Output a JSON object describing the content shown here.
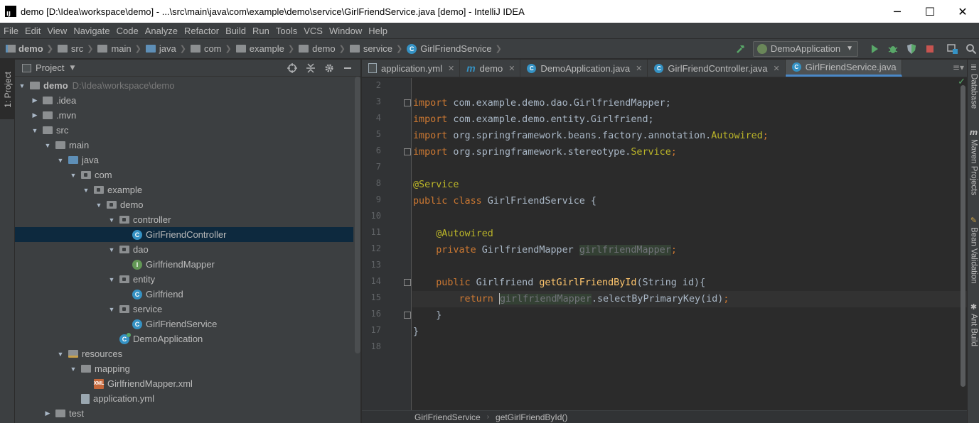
{
  "window": {
    "title": "demo [D:\\Idea\\workspace\\demo] - ...\\src\\main\\java\\com\\example\\demo\\service\\GirlFriendService.java [demo] - IntelliJ IDEA",
    "app_icon_text": "IJ",
    "minimize": "─",
    "maximize": "☐",
    "close": "✕"
  },
  "menu": [
    "File",
    "Edit",
    "View",
    "Navigate",
    "Code",
    "Analyze",
    "Refactor",
    "Build",
    "Run",
    "Tools",
    "VCS",
    "Window",
    "Help"
  ],
  "breadcrumbs": [
    "demo",
    "src",
    "main",
    "java",
    "com",
    "example",
    "demo",
    "service",
    "GirlFriendService"
  ],
  "run_config": {
    "selected": "DemoApplication"
  },
  "left_tool_tab": "1: Project",
  "project_panel": {
    "title": "Project",
    "tree": [
      {
        "label": "demo",
        "path": "D:\\Idea\\workspace\\demo",
        "level": 0,
        "expanded": true,
        "icon": "module-folder-icon"
      },
      {
        "label": ".idea",
        "level": 1,
        "expanded": false,
        "icon": "folder-icon"
      },
      {
        "label": ".mvn",
        "level": 1,
        "expanded": false,
        "icon": "folder-icon"
      },
      {
        "label": "src",
        "level": 1,
        "expanded": true,
        "icon": "folder-icon"
      },
      {
        "label": "main",
        "level": 2,
        "expanded": true,
        "icon": "folder-icon"
      },
      {
        "label": "java",
        "level": 3,
        "expanded": true,
        "icon": "source-folder-icon"
      },
      {
        "label": "com",
        "level": 4,
        "expanded": true,
        "icon": "package-icon"
      },
      {
        "label": "example",
        "level": 5,
        "expanded": true,
        "icon": "package-icon"
      },
      {
        "label": "demo",
        "level": 6,
        "expanded": true,
        "icon": "package-icon"
      },
      {
        "label": "controller",
        "level": 7,
        "expanded": true,
        "icon": "package-icon"
      },
      {
        "label": "GirlFriendController",
        "level": 8,
        "icon": "class-icon",
        "selected": true
      },
      {
        "label": "dao",
        "level": 7,
        "expanded": true,
        "icon": "package-icon"
      },
      {
        "label": "GirlfriendMapper",
        "level": 8,
        "icon": "interface-icon"
      },
      {
        "label": "entity",
        "level": 7,
        "expanded": true,
        "icon": "package-icon"
      },
      {
        "label": "Girlfriend",
        "level": 8,
        "icon": "class-icon"
      },
      {
        "label": "service",
        "level": 7,
        "expanded": true,
        "icon": "package-icon"
      },
      {
        "label": "GirlFriendService",
        "level": 8,
        "icon": "class-icon"
      },
      {
        "label": "DemoApplication",
        "level": 7,
        "icon": "spring-boot-class-icon"
      },
      {
        "label": "resources",
        "level": 3,
        "expanded": true,
        "icon": "resources-folder-icon"
      },
      {
        "label": "mapping",
        "level": 4,
        "expanded": true,
        "icon": "folder-icon"
      },
      {
        "label": "GirlfriendMapper.xml",
        "level": 5,
        "icon": "xml-file-icon"
      },
      {
        "label": "application.yml",
        "level": 4,
        "icon": "yml-file-icon"
      },
      {
        "label": "test",
        "level": 2,
        "expanded": false,
        "icon": "folder-icon"
      }
    ]
  },
  "editor_tabs": [
    {
      "label": "application.yml",
      "icon": "yml-file-icon",
      "active": false
    },
    {
      "label": "demo",
      "icon": "maven-icon",
      "active": false
    },
    {
      "label": "DemoApplication.java",
      "icon": "spring-boot-class-icon",
      "active": false
    },
    {
      "label": "GirlFriendController.java",
      "icon": "class-icon",
      "active": false
    },
    {
      "label": "GirlFriendService.java",
      "icon": "class-icon",
      "active": true
    }
  ],
  "editor": {
    "line_numbers": [
      "2",
      "3",
      "4",
      "5",
      "6",
      "7",
      "8",
      "9",
      "10",
      "11",
      "12",
      "13",
      "14",
      "15",
      "16",
      "17",
      "18"
    ],
    "current_line": "15",
    "code": {
      "l3": {
        "kw": "import",
        "rest": " com.example.demo.dao.GirlfriendMapper;"
      },
      "l4": {
        "kw": "import",
        "rest": " com.example.demo.entity.Girlfriend;"
      },
      "l5": {
        "kw": "import",
        "rest": " org.springframework.beans.factory.annotation.",
        "ann": "Autowired",
        "end": ";"
      },
      "l6": {
        "kw": "import",
        "rest": " org.springframework.stereotype.",
        "ann": "Service",
        "end": ";"
      },
      "l8": {
        "ann": "@Service"
      },
      "l9": {
        "kw": "public class",
        "rest": " GirlFriendService {"
      },
      "l11": {
        "ann": "@Autowired"
      },
      "l12": {
        "kw": "private",
        "type": " GirlfriendMapper ",
        "field": "girlfriendMapper",
        "end": ";"
      },
      "l14": {
        "kw": "public",
        "type": " Girlfriend ",
        "fn": "getGirlFriendById",
        "rest": "(String id){"
      },
      "l15": {
        "kw": "return",
        "field": "girlfriendMapper",
        "rest": ".selectByPrimaryKey(id)",
        "end": ";"
      },
      "l16": {
        "rest": "}"
      },
      "l17": {
        "rest": "}"
      }
    }
  },
  "editor_breadcrumbs": [
    "GirlFriendService",
    "getGirlFriendById()"
  ],
  "right_tool_tabs": [
    "Database",
    "Maven Projects",
    "Bean Validation",
    "Ant Build"
  ],
  "colors": {
    "keyword": "#cc7832",
    "annotation": "#bbb529",
    "field": "#9876aa",
    "method": "#ffc66d",
    "plain": "#a9b7c6",
    "selection": "#0d293e",
    "accent": "#4a88c7"
  }
}
